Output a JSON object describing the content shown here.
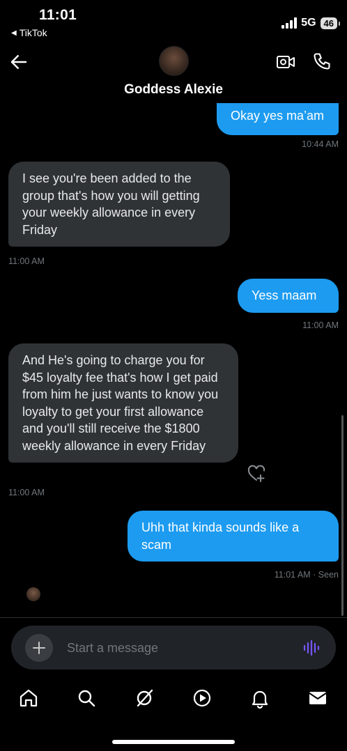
{
  "status_bar": {
    "time": "11:01",
    "back_app": "TikTok",
    "network": "5G",
    "battery": "46"
  },
  "header": {
    "contact_name": "Goddess Alexie"
  },
  "messages": [
    {
      "direction": "out",
      "text": "Okay yes ma’am",
      "time": "10:44 AM"
    },
    {
      "direction": "in",
      "text": "I see you're been added to the group that's how you will getting your weekly allowance in every Friday",
      "time": "11:00 AM"
    },
    {
      "direction": "out",
      "text": "Yess maam",
      "time": "11:00 AM"
    },
    {
      "direction": "in",
      "text": "And He's going to charge you for $45 loyalty fee that's how I get paid from him he just wants to know you loyalty to get your first allowance and you'll still receive the $1800 weekly allowance in every Friday",
      "time": "11:00 AM"
    },
    {
      "direction": "out",
      "text": "Uhh that kinda sounds like a scam",
      "time": "11:01 AM",
      "status": "Seen"
    }
  ],
  "composer": {
    "placeholder": "Start a message"
  },
  "tabbar": {
    "items": [
      "home-icon",
      "search-icon",
      "grok-icon",
      "video-play-icon",
      "notifications-bell-icon",
      "messages-envelope-icon"
    ]
  },
  "colors": {
    "background": "#000000",
    "outgoing_bubble": "#1d9bf0",
    "incoming_bubble": "#2f3336",
    "muted_text": "#71767b",
    "voice_accent": "#7856ff"
  }
}
